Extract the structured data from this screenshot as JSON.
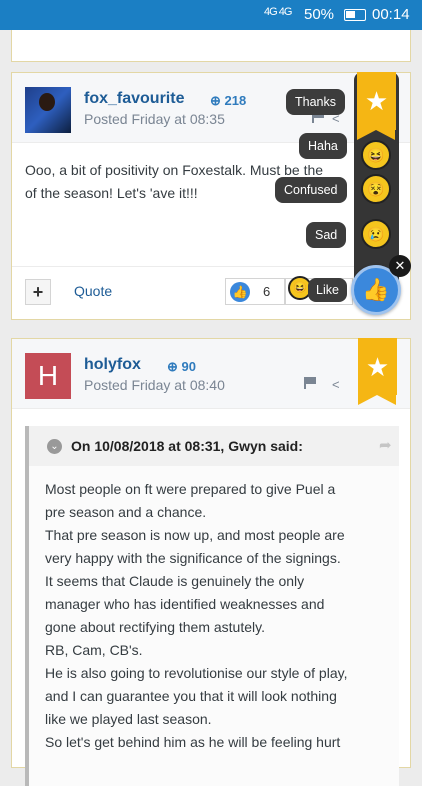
{
  "status": {
    "network": "4G 4G",
    "battery": "50%",
    "time": "00:14"
  },
  "post1": {
    "username": "fox_favourite",
    "reputation": "218",
    "posted": "Posted Friday at 08:35",
    "content": "Ooo, a bit of positivity on Foxestalk. Must be the of the season! Let's 'ave it!!!",
    "content_line1": "Ooo, a bit of positivity on Foxestalk. Must be the",
    "content_line2": "of the season! Let's 'ave it!!!",
    "quote_label": "Quote",
    "like_count": "6",
    "like_label": "Like"
  },
  "reactions": [
    {
      "label": "Thanks",
      "icon": "star-icon"
    },
    {
      "label": "Haha",
      "icon": "laughing-emoji-icon"
    },
    {
      "label": "Confused",
      "icon": "confused-emoji-icon"
    },
    {
      "label": "Sad",
      "icon": "sad-emoji-icon"
    }
  ],
  "post2": {
    "avatar_letter": "H",
    "username": "holyfox",
    "reputation": "90",
    "posted": "Posted Friday at 08:40",
    "quote_title": "On 10/08/2018 at 08:31, Gwyn said:",
    "quote_lines": [
      "Most people on ft were prepared to give Puel a",
      "pre season and a chance.",
      "That pre season is now up, and most people are",
      "very happy with the significance of the signings.",
      "It seems that Claude is genuinely the only",
      "manager who has identified weaknesses and",
      "gone about rectifying them astutely.",
      "RB, Cam, CB's.",
      "He is also going to revolutionise our style of play,",
      "and I can guarantee you that it will look nothing",
      "like we played last season.",
      "So let's get behind him as he will be feeling hurt"
    ]
  }
}
